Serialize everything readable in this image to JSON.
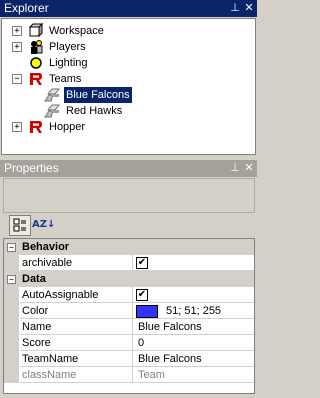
{
  "colors": {
    "title_active": "#0a246a",
    "title_inactive": "#a6a29b",
    "selection": "#0a246a",
    "team_color": "#3333ff"
  },
  "explorer": {
    "title": "Explorer",
    "pin_glyph": "⊥",
    "close_glyph": "✕",
    "items": [
      {
        "label": "Workspace",
        "icon": "workspace-icon",
        "expander": "+",
        "selected": false
      },
      {
        "label": "Players",
        "icon": "players-icon",
        "expander": "+",
        "selected": false
      },
      {
        "label": "Lighting",
        "icon": "lighting-icon",
        "expander": "",
        "selected": false
      },
      {
        "label": "Teams",
        "icon": "teams-icon",
        "expander": "−",
        "selected": false
      },
      {
        "label": "Blue Falcons",
        "icon": "team-icon",
        "expander": "",
        "selected": true
      },
      {
        "label": "Red Hawks",
        "icon": "team-icon",
        "expander": "",
        "selected": false
      },
      {
        "label": "Hopper",
        "icon": "hopper-icon",
        "expander": "+",
        "selected": false
      }
    ]
  },
  "properties": {
    "title": "Properties",
    "pin_glyph": "⊥",
    "close_glyph": "✕",
    "toolbar": {
      "categorized_icon": "categorized-sort-icon",
      "alpha_label": "AZ↓"
    },
    "rows": [
      {
        "kind": "category",
        "toggle": "−",
        "name": "Behavior"
      },
      {
        "kind": "prop",
        "name": "archivable",
        "type": "checkbox",
        "checked": true,
        "value": ""
      },
      {
        "kind": "category",
        "toggle": "−",
        "name": "Data"
      },
      {
        "kind": "prop",
        "name": "AutoAssignable",
        "type": "checkbox",
        "checked": true,
        "value": ""
      },
      {
        "kind": "prop",
        "name": "Color",
        "type": "color",
        "value": "51; 51; 255"
      },
      {
        "kind": "prop",
        "name": "Name",
        "type": "text",
        "value": "Blue Falcons"
      },
      {
        "kind": "prop",
        "name": "Score",
        "type": "text",
        "value": "0"
      },
      {
        "kind": "prop",
        "name": "TeamName",
        "type": "text",
        "value": "Blue Falcons"
      },
      {
        "kind": "prop",
        "name": "className",
        "type": "readonly",
        "value": "Team"
      }
    ],
    "check_glyph": "✔"
  }
}
